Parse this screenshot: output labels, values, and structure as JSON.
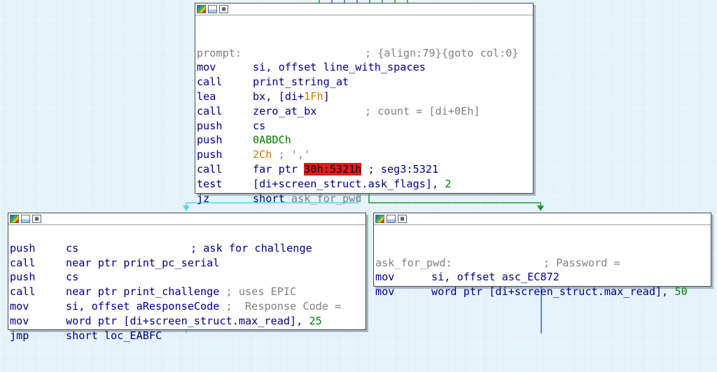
{
  "colors": {
    "background": "#e4f2fa",
    "edge_true": "#57d3ea",
    "edge_false": "#1f9a2e",
    "edge_flow": "#3a5fcd",
    "highlight": "#e11b1b",
    "mnemonic": "#000080",
    "comment": "#808080",
    "number": "#008000",
    "hex_number": "#cc7a00"
  },
  "header_icons": [
    "color-palette-icon",
    "rename-icon",
    "graph-overview-icon"
  ],
  "node_main": {
    "label": "prompt:",
    "label_comment": "; {align:79}{goto col:0}",
    "l1_mn": "mov",
    "l1_op": "si, offset line_with_spaces",
    "l2_mn": "call",
    "l2_op": "print_string_at",
    "l3_mn": "lea",
    "l3_op_a": "bx, [di+",
    "l3_op_hex": "1Fh",
    "l3_op_b": "]",
    "l4_mn": "call",
    "l4_op": "zero_at_bx",
    "l4_cmt": "; count = [di+0Eh]",
    "l5_mn": "push",
    "l5_op": "cs",
    "l6_mn": "push",
    "l6_op": "0ABDCh",
    "l7_mn": "push",
    "l7_hex": "2Ch",
    "l7_cmt": " ; ','",
    "l8_mn": "call",
    "l8_op": "far ptr ",
    "l8_hl": "30h:5321h",
    "l8_cmt": " ; seg3:5321",
    "l9_mn": "test",
    "l9_op": "[di+screen_struct.ask_flags], ",
    "l9_num": "2",
    "l10_mn": "jz",
    "l10_op": "short ",
    "l10_target": "ask_for_pwd"
  },
  "node_left": {
    "l1_mn": "push",
    "l1_op": "cs",
    "l1_cmt": "; ask for challenge",
    "l2_mn": "call",
    "l2_op": "near ptr print_pc_serial",
    "l3_mn": "push",
    "l3_op": "cs",
    "l4_mn": "call",
    "l4_op": "near ptr print_challenge",
    "l4_cmt": " ; uses EPIC",
    "l5_mn": "mov",
    "l5_op": "si, offset aResponseCode",
    "l5_cmt": " ;  Response Code =",
    "l6_mn": "mov",
    "l6_op": "word ptr [di+screen_struct.max_read], ",
    "l6_num": "25",
    "l7_mn": "jmp",
    "l7_op": "short loc_EABFC"
  },
  "node_right": {
    "label": "ask_for_pwd:",
    "label_comment": "; Password =",
    "l1_mn": "mov",
    "l1_op": "si, offset asc_EC872",
    "l2_mn": "mov",
    "l2_op": "word ptr [di+screen_struct.max_read], ",
    "l2_num": "50"
  }
}
